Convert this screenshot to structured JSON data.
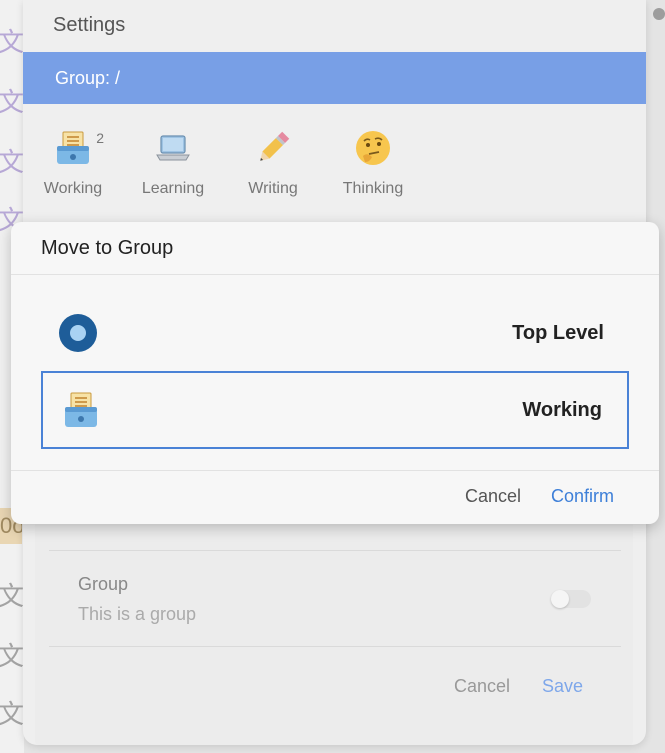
{
  "background": {
    "glyph": "文",
    "chip_text": "0o"
  },
  "settings": {
    "title": "Settings",
    "group_path": "Group: /",
    "groups": [
      {
        "label": "Working",
        "icon": "card-index-box-icon",
        "badge": "2"
      },
      {
        "label": "Learning",
        "icon": "laptop-icon",
        "badge": ""
      },
      {
        "label": "Writing",
        "icon": "pencil-icon",
        "badge": ""
      },
      {
        "label": "Thinking",
        "icon": "thinking-face-icon",
        "badge": ""
      }
    ],
    "edit_card": {
      "row_title": "Group",
      "row_subtitle": "This is a group",
      "cancel_label": "Cancel",
      "save_label": "Save"
    }
  },
  "modal": {
    "title": "Move to Group",
    "options": [
      {
        "label": "Top Level",
        "icon": "radio-selected-icon"
      },
      {
        "label": "Working",
        "icon": "card-index-box-icon"
      }
    ],
    "cancel_label": "Cancel",
    "confirm_label": "Confirm"
  },
  "colors": {
    "accent": "#789fe6",
    "selected_border": "#4a82d6",
    "confirm": "#3d7fd8"
  }
}
